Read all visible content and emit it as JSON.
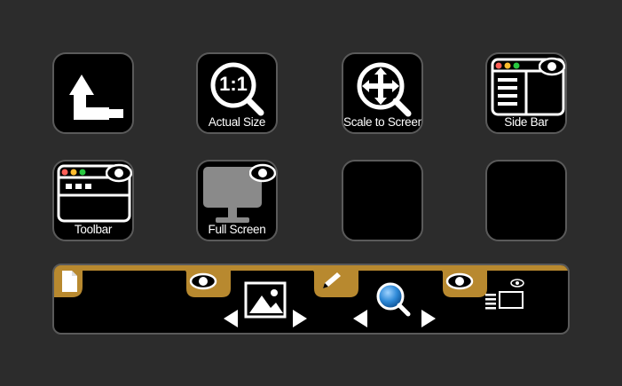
{
  "keys": [
    {
      "id": "back",
      "label": ""
    },
    {
      "id": "actual-size",
      "label": "Actual Size",
      "glyph": "1:1"
    },
    {
      "id": "scale-to-screen",
      "label": "Scale to Screen"
    },
    {
      "id": "side-bar",
      "label": "Side Bar"
    },
    {
      "id": "toolbar",
      "label": "Toolbar"
    },
    {
      "id": "full-screen",
      "label": "Full Screen"
    },
    {
      "id": "empty-1",
      "label": ""
    },
    {
      "id": "empty-2",
      "label": ""
    }
  ],
  "touchstrip": {
    "segments": [
      {
        "icon": "document-icon"
      },
      {
        "icon": "eye-icon",
        "control": "image-icon"
      },
      {
        "icon": "pencil-icon",
        "control": "magnifier-icon"
      },
      {
        "icon": "eye-icon",
        "control": "sidebar-layout-icon"
      }
    ]
  },
  "colors": {
    "background": "#2c2c2c",
    "key_border": "#5a5a5a",
    "accent_gold": "#b8892f",
    "traffic_red": "#ff5f57",
    "traffic_yellow": "#febc2e",
    "traffic_green": "#28c840",
    "magnifier_blue": "#2f8ad8"
  }
}
